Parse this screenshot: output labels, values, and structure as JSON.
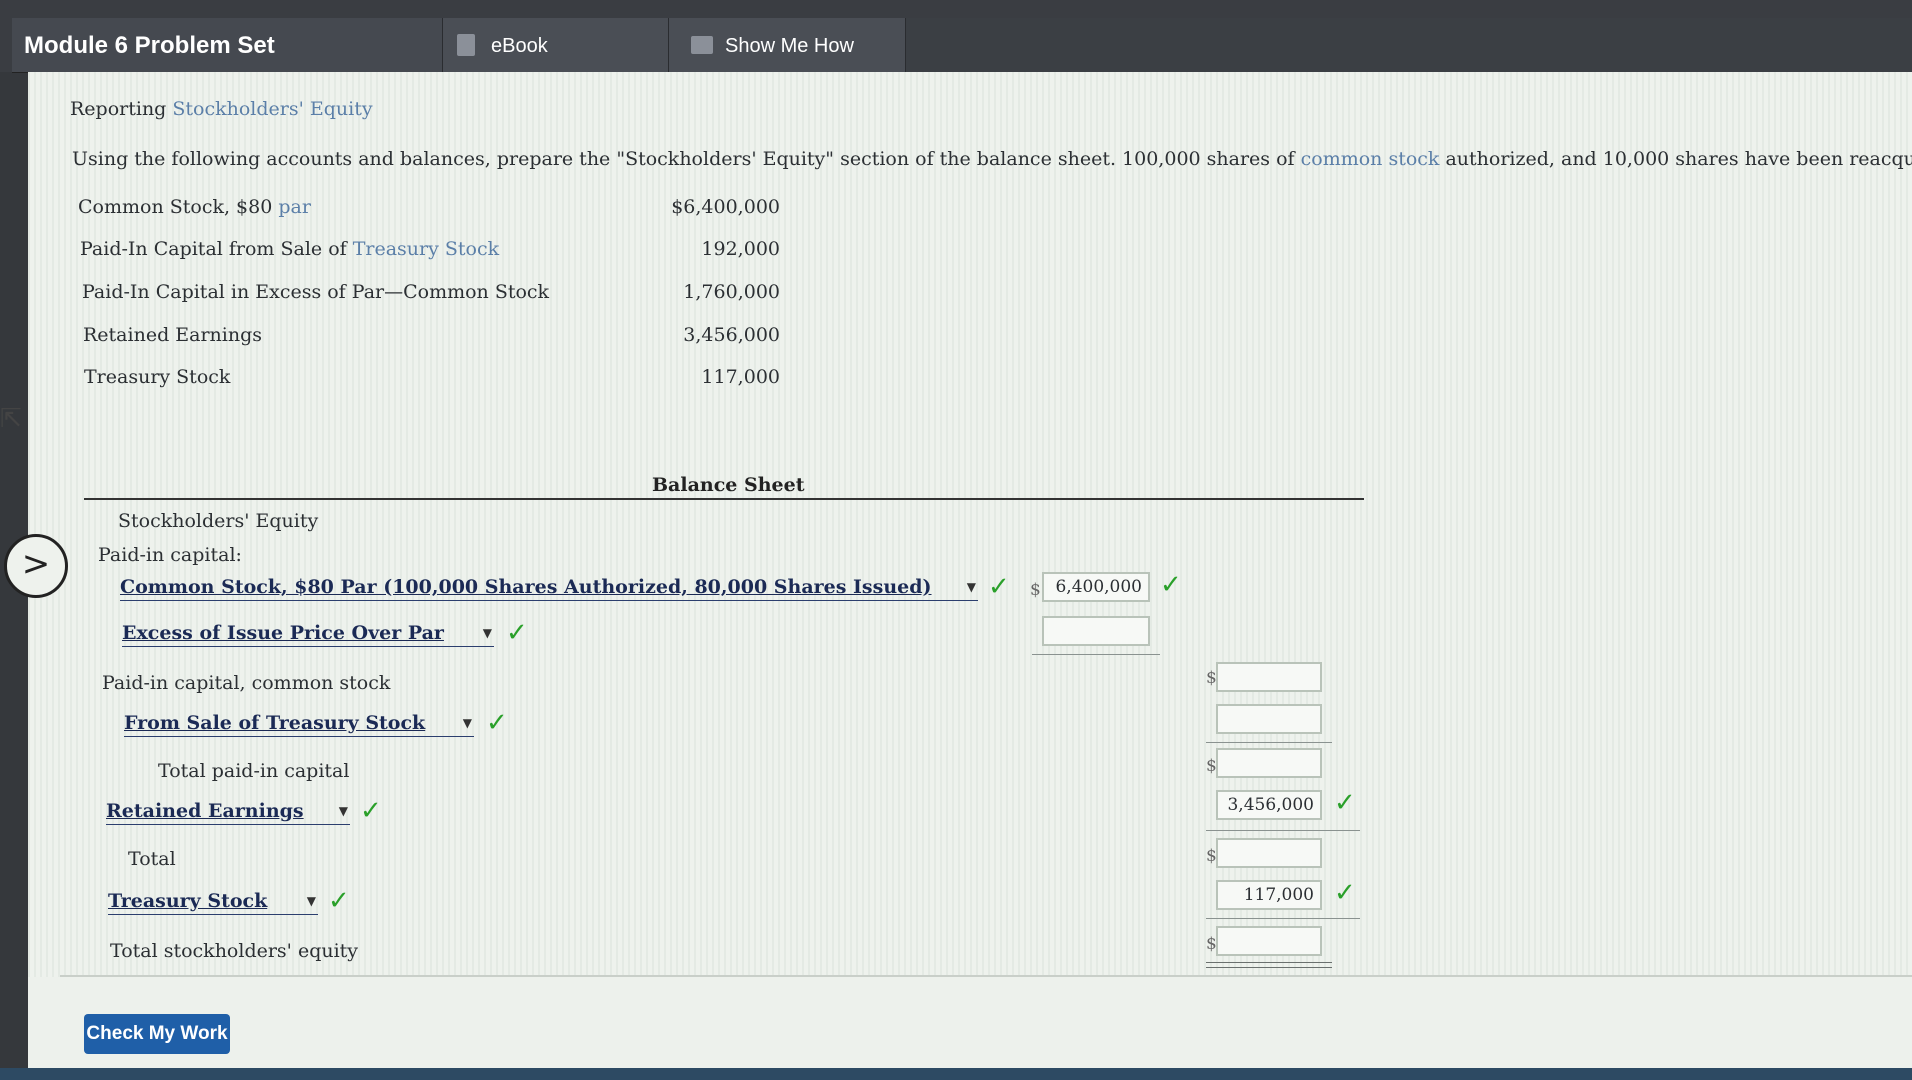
{
  "header": {
    "title": "Module 6 Problem Set",
    "tabs": [
      {
        "label": "eBook"
      },
      {
        "label": "Show Me How"
      }
    ]
  },
  "problem": {
    "title_prefix": "Reporting ",
    "title_link": "Stockholders' Equity",
    "instructions": {
      "part1": "Using the following accounts and balances, prepare the \"Stockholders' Equity\" section of the balance sheet. 100,000 shares of ",
      "link": "common stock",
      "part2": " authorized, and 10,000 shares have been reacquire"
    },
    "accounts": [
      {
        "name": "Common Stock, $80 ",
        "link": "par",
        "amount": "$6,400,000"
      },
      {
        "name": "Paid-In Capital from Sale of ",
        "link": "Treasury Stock",
        "amount": "192,000"
      },
      {
        "name": "Paid-In Capital in Excess of Par—Common Stock",
        "link": "",
        "amount": "1,760,000"
      },
      {
        "name": "Retained Earnings",
        "link": "",
        "amount": "3,456,000"
      },
      {
        "name": "Treasury Stock",
        "link": "",
        "amount": "117,000"
      }
    ]
  },
  "balance_sheet": {
    "heading": "Balance Sheet",
    "section": "Stockholders' Equity",
    "paid_in_label": "Paid-in capital:",
    "common_stock_select": "Common Stock, $80 Par (100,000 Shares Authorized, 80,000 Shares Issued)",
    "common_stock_value": "6,400,000",
    "excess_select": "Excess of Issue Price Over Par",
    "paid_in_common_label": "Paid-in capital, common stock",
    "treasury_sale_select": "From Sale of Treasury Stock",
    "total_paid_in_label": "Total paid-in capital",
    "retained_select": "Retained Earnings",
    "retained_value": "3,456,000",
    "total_label": "Total",
    "treasury_select": "Treasury Stock",
    "treasury_value": "117,000",
    "total_equity_label": "Total stockholders' equity",
    "currency": "$"
  },
  "footer": {
    "check_button": "Check My Work"
  },
  "colors": {
    "check": "#2aa02a",
    "button": "#1f5fa8",
    "link": "#5b7fa8"
  }
}
